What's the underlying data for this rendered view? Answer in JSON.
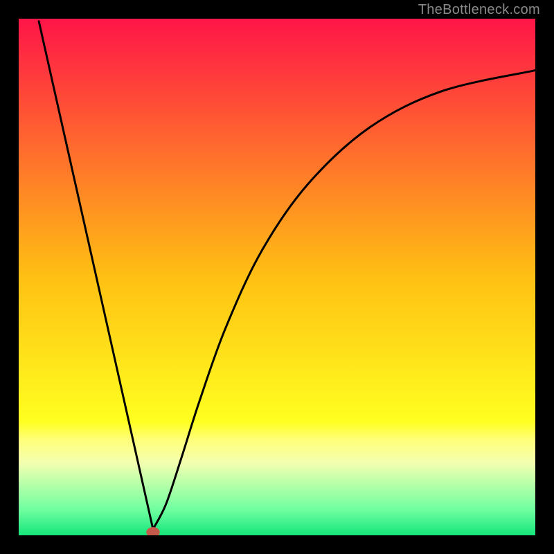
{
  "source_label": "TheBottleneck.com",
  "chart_data": {
    "type": "line",
    "title": "",
    "xlabel": "",
    "ylabel": "",
    "xlim": [
      0,
      1
    ],
    "ylim": [
      0,
      1
    ],
    "gradient_stops": [
      {
        "offset": 0.0,
        "color": "#ff1548"
      },
      {
        "offset": 0.5,
        "color": "#ffc013"
      },
      {
        "offset": 0.78,
        "color": "#ffff20"
      },
      {
        "offset": 0.815,
        "color": "#ffff7a"
      },
      {
        "offset": 0.86,
        "color": "#f3ffb0"
      },
      {
        "offset": 0.95,
        "color": "#70ffa0"
      },
      {
        "offset": 1.0,
        "color": "#14e57a"
      }
    ],
    "curve": {
      "left_segment": {
        "x1": 0.039,
        "y1": 0.995,
        "x2": 0.26,
        "y2": 0.012
      },
      "vertex": {
        "x": 0.26,
        "y": 0.012
      },
      "right_sample_points": [
        {
          "x": 0.26,
          "y": 0.012
        },
        {
          "x": 0.285,
          "y": 0.06
        },
        {
          "x": 0.315,
          "y": 0.15
        },
        {
          "x": 0.35,
          "y": 0.26
        },
        {
          "x": 0.4,
          "y": 0.4
        },
        {
          "x": 0.47,
          "y": 0.55
        },
        {
          "x": 0.56,
          "y": 0.68
        },
        {
          "x": 0.68,
          "y": 0.79
        },
        {
          "x": 0.82,
          "y": 0.86
        },
        {
          "x": 1.0,
          "y": 0.9
        }
      ]
    },
    "marker": {
      "x": 0.26,
      "y": 0.006,
      "rx": 0.013,
      "ry": 0.01,
      "color": "#c35a4b"
    }
  }
}
